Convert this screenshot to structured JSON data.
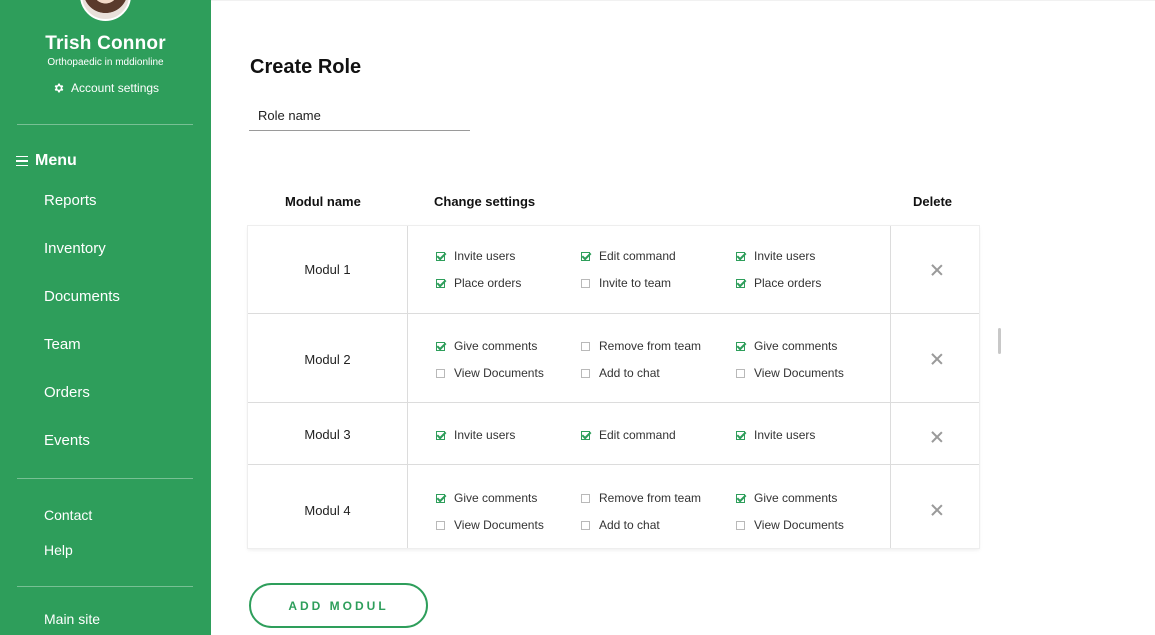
{
  "user": {
    "name": "Trish Connor",
    "subtitle": "Orthopaedic in mddionline",
    "account_settings_label": "Account settings"
  },
  "menu": {
    "heading": "Menu",
    "items": [
      "Reports",
      "Inventory",
      "Documents",
      "Team",
      "Orders",
      "Events"
    ],
    "secondary": [
      "Contact",
      "Help"
    ],
    "main_site": "Main site"
  },
  "page": {
    "title": "Create Role",
    "role_name_placeholder": "Role name"
  },
  "table": {
    "headers": {
      "module": "Modul name",
      "settings": "Change settings",
      "delete": "Delete"
    },
    "rows": [
      {
        "name": "Modul 1",
        "options": [
          {
            "label": "Invite users",
            "checked": true
          },
          {
            "label": "Edit command",
            "checked": true
          },
          {
            "label": "Invite users",
            "checked": true
          },
          {
            "label": "Place orders",
            "checked": true
          },
          {
            "label": "Invite to team",
            "checked": false
          },
          {
            "label": "Place orders",
            "checked": true
          }
        ]
      },
      {
        "name": "Modul 2",
        "options": [
          {
            "label": "Give comments",
            "checked": true
          },
          {
            "label": "Remove from team",
            "checked": false
          },
          {
            "label": "Give comments",
            "checked": true
          },
          {
            "label": "View Documents",
            "checked": false
          },
          {
            "label": "Add to chat",
            "checked": false
          },
          {
            "label": "View Documents",
            "checked": false
          }
        ]
      },
      {
        "name": "Modul 3",
        "options": [
          {
            "label": "Invite users",
            "checked": true
          },
          {
            "label": "Edit command",
            "checked": true
          },
          {
            "label": "Invite users",
            "checked": true
          }
        ]
      },
      {
        "name": "Modul 4",
        "options": [
          {
            "label": "Give comments",
            "checked": true
          },
          {
            "label": "Remove from team",
            "checked": false
          },
          {
            "label": "Give comments",
            "checked": true
          },
          {
            "label": "View Documents",
            "checked": false
          },
          {
            "label": "Add to chat",
            "checked": false
          },
          {
            "label": "View Documents",
            "checked": false
          }
        ]
      }
    ]
  },
  "add_button_label": "ADD MODUL",
  "colors": {
    "accent": "#2e9e5b",
    "divider": "#dcdcdc",
    "delete_icon": "#9a9a9a"
  }
}
